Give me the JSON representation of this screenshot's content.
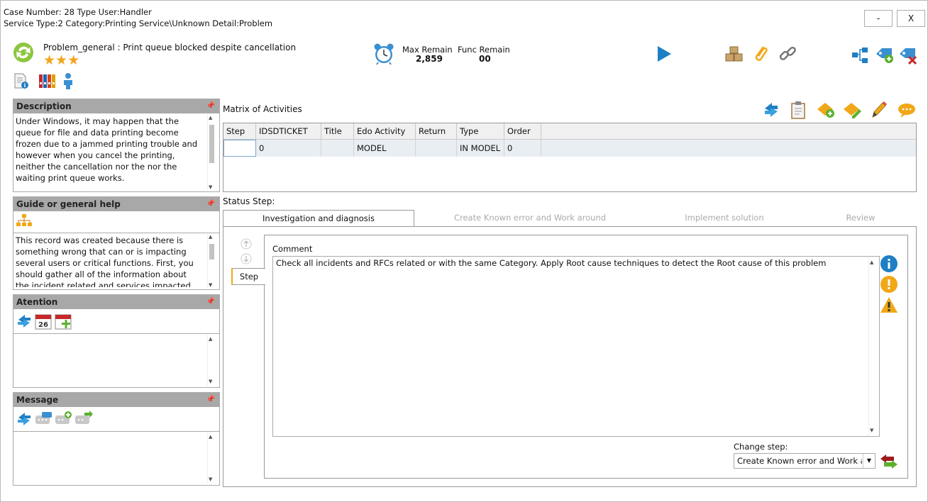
{
  "header": {
    "line1": "Case Number: 28 Type User:Handler",
    "line2": "Service Type:2 Category:Printing Service\\Unknown Detail:Problem",
    "minimize_label": "-",
    "close_label": "X"
  },
  "ticket": {
    "title": "Problem_general : Print queue blocked despite cancellation",
    "stars": 3,
    "stars_text": "★★★",
    "max_remain_label": "Max Remain",
    "max_remain_value": "2,859",
    "func_remain_label": "Func Remain",
    "func_remain_value": "00"
  },
  "panels": {
    "description": {
      "title": "Description",
      "text": "Under Windows, it may happen that the queue for file and data printing become frozen due to a jammed printing trouble and however when you cancel the printing, neither the cancellation nor the nor the waiting print queue works."
    },
    "guide": {
      "title": "Guide or general help",
      "text": "This record was created because there is something wrong that can or is impacting several users or critical functions. First, you should gather all of the information about the incident related and services impacted, then"
    },
    "attention": {
      "title": "Atention",
      "calendar_day": "26"
    },
    "message": {
      "title": "Message"
    },
    "pin": "ᵖ"
  },
  "matrix": {
    "title": "Matrix of Activities",
    "columns": [
      "Step",
      "IDSDTICKET",
      "Title",
      "Edo Activity",
      "Return",
      "Type",
      "Order"
    ],
    "rows": [
      [
        "",
        "0",
        "",
        "MODEL",
        "",
        "IN MODEL",
        "0"
      ]
    ]
  },
  "status": {
    "label": "Status Step:",
    "steps": [
      "Investigation and diagnosis",
      "Create Known error and Work around",
      "Implement solution",
      "Review"
    ],
    "side_tab": "Step",
    "comment_label": "Comment",
    "comment_text": "Check all incidents and RFCs related or with the same Category. Apply Root cause techniques to detect the Root cause of this problem",
    "change_step_label": "Change step:",
    "change_step_value": "Create Known error and Work a"
  },
  "colors": {
    "panel_header": "#a8a8a8",
    "row_highlight": "#e9eef3",
    "accent_blue": "#1f7fc4",
    "accent_orange": "#f0a818",
    "star": "#f2a51c"
  },
  "icons": [
    "refresh-icon",
    "document-info-icon",
    "binders-icon",
    "person-icon",
    "alarm-clock-icon",
    "play-icon",
    "boxes-icon",
    "paperclip-icon",
    "link-icon",
    "hierarchy-icon",
    "tag-add-icon",
    "tag-delete-icon",
    "sync-icon",
    "clipboard-icon",
    "ticket-add-icon",
    "ticket-edit-icon",
    "pencil-icon",
    "chat-icon",
    "org-chart-icon",
    "calendar-icon",
    "calendar-add-icon",
    "message-icon",
    "message-add-icon",
    "message-forward-icon",
    "arrow-up-icon",
    "arrow-down-icon",
    "info-icon",
    "exclamation-icon",
    "warning-icon",
    "swap-arrows-icon"
  ]
}
